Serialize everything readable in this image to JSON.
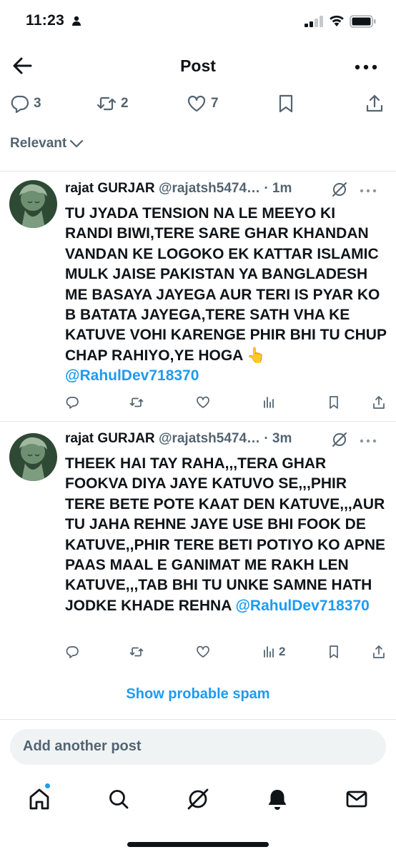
{
  "status_bar": {
    "time": "11:23"
  },
  "header": {
    "title": "Post"
  },
  "post_actions": {
    "replies": "3",
    "reposts": "2",
    "likes": "7"
  },
  "sort": {
    "label": "Relevant"
  },
  "replies": [
    {
      "name": "rajat GURJAR",
      "handle": "@rajatsh5474…",
      "time": "· 1m",
      "text": "TU JYADA TENSION NA LE MEEYO KI RANDI BIWI,TERE SARE GHAR KHANDAN VANDAN KE LOGOKO EK KATTAR ISLAMIC MULK JAISE PAKISTAN YA BANGLADESH ME BASAYA JAYEGA AUR TERI IS PYAR KO B BATATA JAYEGA,TERE SATH VHA KE KATUVE VOHI KARENGE PHIR BHI TU CHUP CHAP RAHIYO,YE HOGA 👆",
      "mention": "@RahulDev718370",
      "views": ""
    },
    {
      "name": "rajat GURJAR",
      "handle": "@rajatsh5474…",
      "time": "· 3m",
      "text": "THEEK HAI TAY RAHA,,,TERA GHAR FOOKVA DIYA JAYE KATUVO SE,,,PHIR TERE BETE POTE KAAT DEN KATUVE,,,AUR TU JAHA REHNE JAYE USE BHI FOOK DE KATUVE,,PHIR TERE BETI POTIYO KO APNE PAAS MAAL E GANIMAT ME RAKH LEN KATUVE,,,TAB BHI TU UNKE SAMNE HATH JODKE KHADE REHNA",
      "mention": "@RahulDev718370",
      "views": "2"
    }
  ],
  "spam_link": "Show probable spam",
  "compose": {
    "placeholder": "Add another post"
  },
  "tabs": [
    "home",
    "search",
    "grok",
    "notifications",
    "messages"
  ],
  "colors": {
    "accent": "#1d9bf0",
    "secondary_text": "#536471"
  }
}
